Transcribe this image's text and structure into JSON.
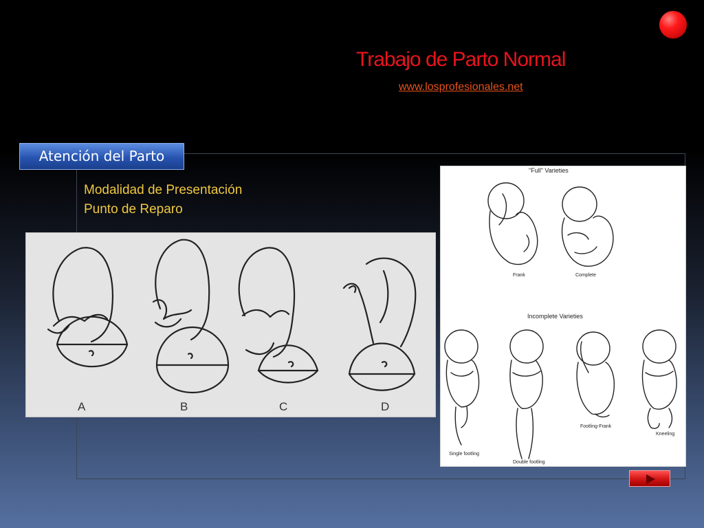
{
  "slide": {
    "title": "Trabajo de Parto Normal",
    "website": "www.losprofesionales.net",
    "tab_label": "Atención del Parto",
    "lines": [
      "Modalidad de Presentación",
      "Punto de Reparo"
    ]
  },
  "left_figure": {
    "labels": [
      "A",
      "B",
      "C",
      "D"
    ]
  },
  "right_figure": {
    "full_heading": "\"Full\" Varieties",
    "full_labels": [
      "Frank",
      "Complete"
    ],
    "incomplete_heading": "Incomplete Varieties",
    "incomplete_labels": [
      "Single footling",
      "Double footling",
      "Footling-Frank",
      "Kneeling"
    ]
  },
  "colors": {
    "title": "#e8141c",
    "body_text": "#f0c840",
    "tab": "#2754b0",
    "next_button": "#d81818"
  },
  "icons": {
    "corner": "red-dot-icon",
    "next": "next-arrow-icon"
  }
}
